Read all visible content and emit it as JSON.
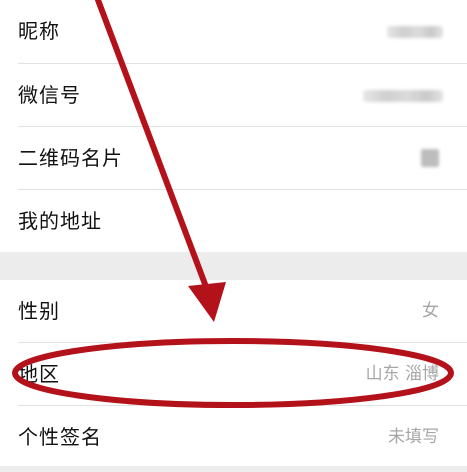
{
  "profile": {
    "rows_top": [
      {
        "label": "昵称"
      },
      {
        "label": "微信号"
      },
      {
        "label": "二维码名片"
      },
      {
        "label": "我的地址"
      }
    ],
    "rows_bottom": [
      {
        "label": "性别",
        "value": "女"
      },
      {
        "label": "地区",
        "value": "山东 淄博"
      },
      {
        "label": "个性签名",
        "value": "未填写"
      }
    ]
  },
  "colors": {
    "annotation": "#b3121a",
    "section_gap": "#ececec",
    "value_text": "#a6a6a6"
  },
  "icons": {
    "qr_thumbnail": "qr-code-blurred"
  }
}
